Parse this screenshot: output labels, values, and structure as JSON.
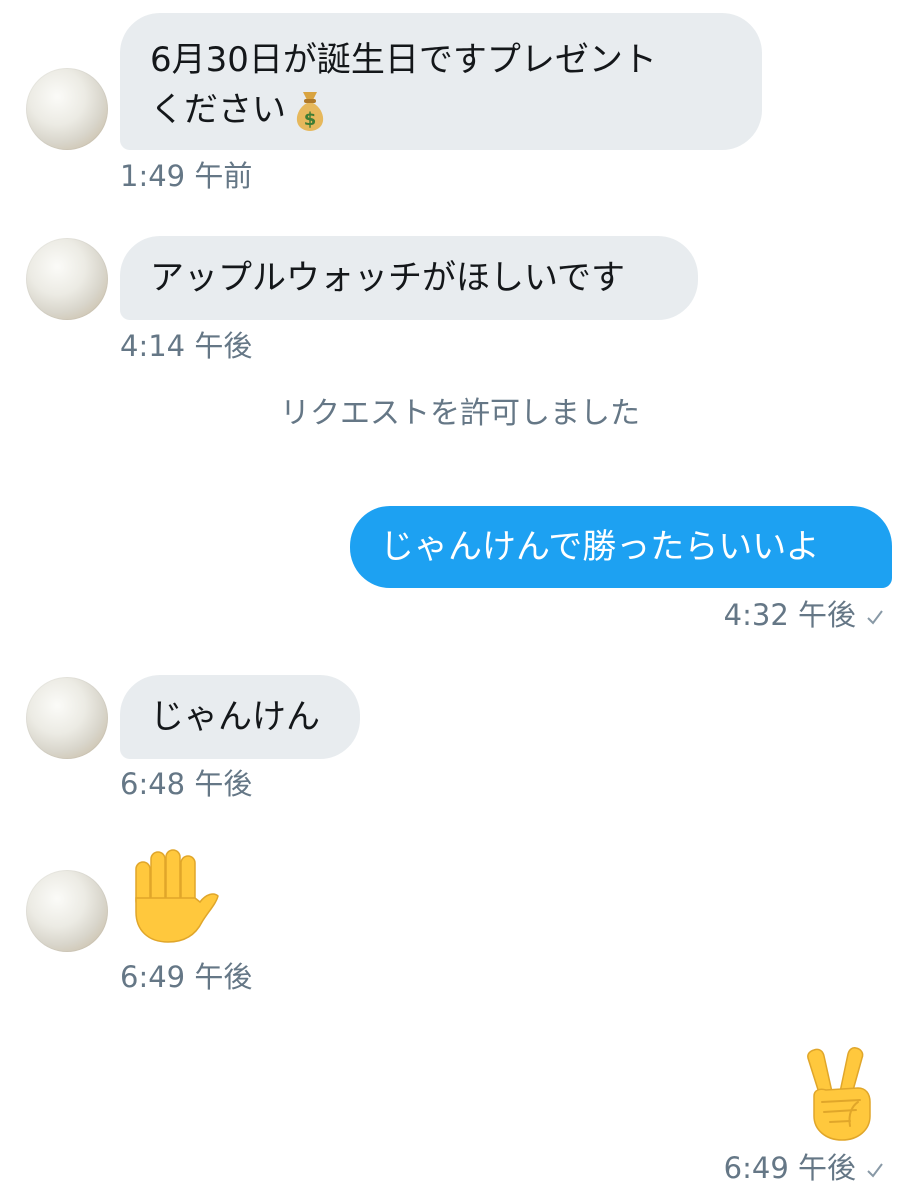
{
  "messages": [
    {
      "line1": "6月30日が誕生日ですプレゼント",
      "line2": "ください",
      "time": "1:49 午前"
    },
    {
      "text": "アップルウォッチがほしいです",
      "time": "4:14 午後"
    },
    {
      "system": "リクエストを許可しました"
    },
    {
      "text": "じゃんけんで勝ったらいいよ",
      "time": "4:32 午後"
    },
    {
      "text": "じゃんけん",
      "time": "6:48 午後"
    },
    {
      "emoji": "raised-hand",
      "time": "6:49 午後"
    },
    {
      "emoji": "victory-hand",
      "time": "6:49 午後"
    }
  ],
  "colors": {
    "incoming_bubble": "#e8ecef",
    "outgoing_bubble": "#1da1f2",
    "timestamp": "#657786",
    "emoji_skin": "#ffc83d"
  },
  "icons": [
    "money-bag-icon",
    "raised-hand-icon",
    "victory-hand-icon",
    "read-check-icon"
  ]
}
